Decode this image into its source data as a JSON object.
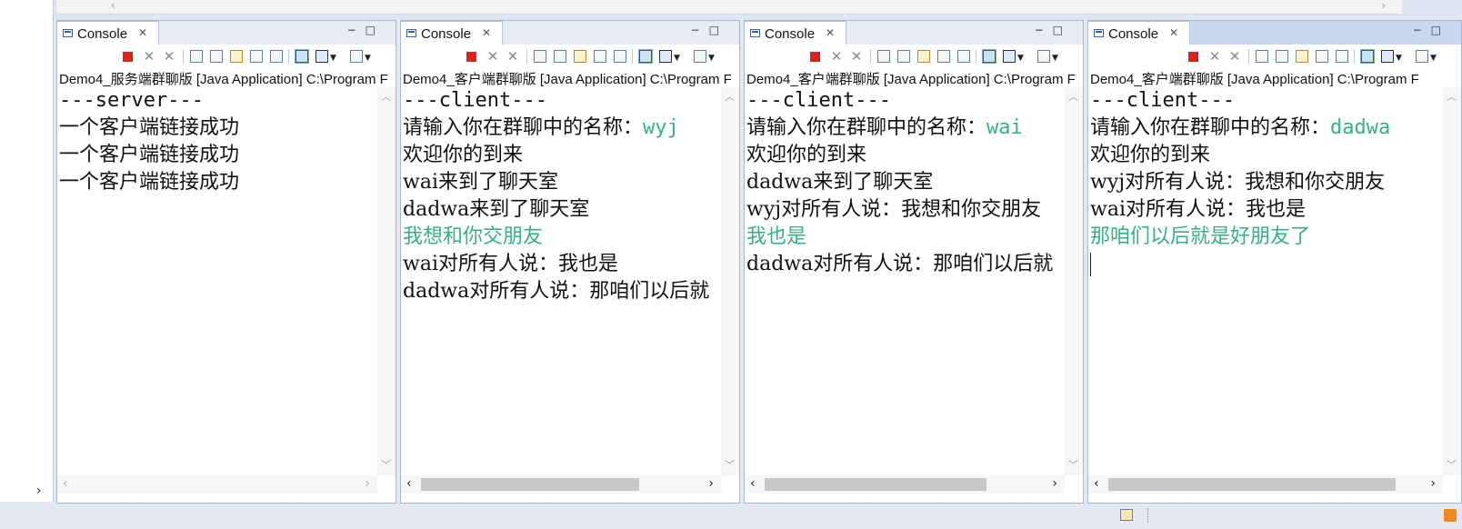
{
  "consoles": [
    {
      "tab_label": "Console",
      "process": "Demo4_服务端群聊版 [Java Application] C:\\Program F",
      "lines": [
        {
          "parts": [
            {
              "text": "---server---",
              "input": false
            }
          ]
        },
        {
          "parts": [
            {
              "text": "一个客户端链接成功",
              "input": false
            }
          ]
        },
        {
          "parts": [
            {
              "text": "一个客户端链接成功",
              "input": false
            }
          ]
        },
        {
          "parts": [
            {
              "text": "一个客户端链接成功",
              "input": false
            }
          ]
        }
      ]
    },
    {
      "tab_label": "Console",
      "process": "Demo4_客户端群聊版 [Java Application] C:\\Program F",
      "lines": [
        {
          "parts": [
            {
              "text": "---client---",
              "input": false
            }
          ]
        },
        {
          "parts": [
            {
              "text": "请输入你在群聊中的名称：",
              "input": false
            },
            {
              "text": "wyj",
              "input": true
            }
          ]
        },
        {
          "parts": [
            {
              "text": "欢迎你的到来",
              "input": false
            }
          ]
        },
        {
          "parts": [
            {
              "text": "wai来到了聊天室",
              "input": false
            }
          ]
        },
        {
          "parts": [
            {
              "text": "dadwa来到了聊天室",
              "input": false
            }
          ]
        },
        {
          "parts": [
            {
              "text": "我想和你交朋友",
              "input": true
            }
          ]
        },
        {
          "parts": [
            {
              "text": "wai对所有人说：我也是",
              "input": false
            }
          ]
        },
        {
          "parts": [
            {
              "text": "dadwa对所有人说：那咱们以后就",
              "input": false
            }
          ]
        }
      ]
    },
    {
      "tab_label": "Console",
      "process": "Demo4_客户端群聊版 [Java Application] C:\\Program F",
      "lines": [
        {
          "parts": [
            {
              "text": "---client---",
              "input": false
            }
          ]
        },
        {
          "parts": [
            {
              "text": "请输入你在群聊中的名称：",
              "input": false
            },
            {
              "text": "wai",
              "input": true
            }
          ]
        },
        {
          "parts": [
            {
              "text": "欢迎你的到来",
              "input": false
            }
          ]
        },
        {
          "parts": [
            {
              "text": "dadwa来到了聊天室",
              "input": false
            }
          ]
        },
        {
          "parts": [
            {
              "text": "wyj对所有人说：我想和你交朋友",
              "input": false
            }
          ]
        },
        {
          "parts": [
            {
              "text": "我也是",
              "input": true
            }
          ]
        },
        {
          "parts": [
            {
              "text": "dadwa对所有人说：那咱们以后就",
              "input": false
            }
          ]
        }
      ]
    },
    {
      "tab_label": "Console",
      "process": "Demo4_客户端群聊版 [Java Application] C:\\Program F",
      "lines": [
        {
          "parts": [
            {
              "text": "---client---",
              "input": false
            }
          ]
        },
        {
          "parts": [
            {
              "text": "请输入你在群聊中的名称：",
              "input": false
            },
            {
              "text": "dadwa",
              "input": true
            }
          ]
        },
        {
          "parts": [
            {
              "text": "欢迎你的到来",
              "input": false
            }
          ]
        },
        {
          "parts": [
            {
              "text": "wyj对所有人说：我想和你交朋友",
              "input": false
            }
          ]
        },
        {
          "parts": [
            {
              "text": "wai对所有人说：我也是",
              "input": false
            }
          ]
        },
        {
          "parts": [
            {
              "text": "那咱们以后就是好朋友了",
              "input": true
            }
          ]
        }
      ]
    }
  ],
  "colors": {
    "stdin_text": "#37b089",
    "stdout_text": "#111111",
    "terminate_button": "#e0201b"
  },
  "icons": {
    "tab": "console-icon",
    "toolbar": [
      "terminate-icon",
      "remove-launch-icon",
      "remove-all-terminated-icon",
      "clear-console-icon",
      "scroll-lock-icon",
      "word-wrap-icon",
      "show-on-stdout-icon",
      "show-on-stderr-icon",
      "pin-console-icon",
      "display-selected-console-icon",
      "open-console-icon"
    ]
  }
}
